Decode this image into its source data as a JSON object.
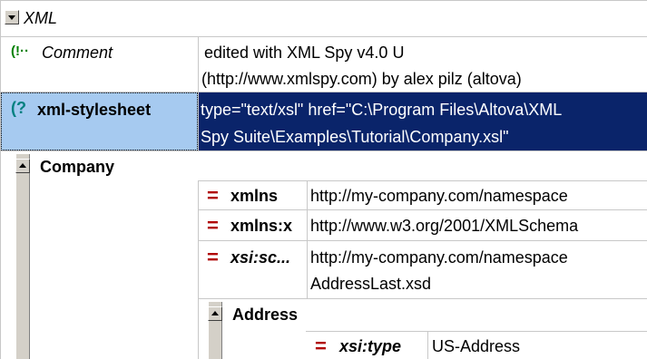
{
  "root": {
    "label": "XML"
  },
  "comment": {
    "label": "Comment",
    "value_line1": "edited with XML Spy v4.0 U",
    "value_line2": "(http://www.xmlspy.com) by alex pilz (altova)"
  },
  "pi": {
    "label": "xml-stylesheet",
    "value_line1": "type=\"text/xsl\" href=\"C:\\Program Files\\Altova\\XML",
    "value_line2": "Spy Suite\\Examples\\Tutorial\\Company.xsl\""
  },
  "company": {
    "label": "Company",
    "attributes": [
      {
        "symbol": "=",
        "name": "xmlns",
        "value_line1": "http://my-company.com/namespace",
        "value_line2": ""
      },
      {
        "symbol": "=",
        "name": "xmlns:x",
        "value_line1": "http://www.w3.org/2001/XMLSchema",
        "value_line2": ""
      },
      {
        "symbol": "=",
        "name": "xsi:sc...",
        "value_line1": "http://my-company.com/namespace",
        "value_line2": "AddressLast.xsd"
      }
    ],
    "address": {
      "label": "Address",
      "attributes": [
        {
          "symbol": "=",
          "name": "xsi:type",
          "value": "US-Address"
        }
      ]
    }
  },
  "colors": {
    "selection": "#0a246a",
    "selected_label_bg": "#a6caf0",
    "attr_symbol": "#b00000",
    "pi_icon": "#008080"
  }
}
